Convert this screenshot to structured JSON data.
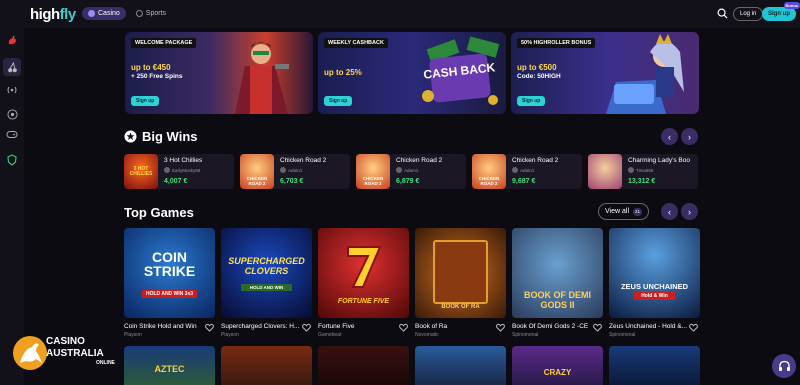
{
  "header": {
    "logo": {
      "part1": "high",
      "part2": "fly"
    },
    "modes": [
      {
        "label": "Casino"
      },
      {
        "label": "Sports"
      }
    ],
    "login_label": "Log in",
    "signup_label": "Sign up",
    "signup_badge": "Bonus"
  },
  "promos": [
    {
      "tag": "WELCOME PACKAGE",
      "amount": "up to €450",
      "sub": "+ 250 Free Spins",
      "button": "Sign up"
    },
    {
      "tag": "WEEKLY CASHBACK",
      "amount": "up to 25%",
      "sub": "",
      "art_text": "CASH BACK",
      "button": "Sign up"
    },
    {
      "tag": "50% HIGHROLLER BONUS",
      "amount": "up to €500",
      "sub": "Code: 50HIGH",
      "button": "Sign up"
    }
  ],
  "big_wins": {
    "title": "Big Wins",
    "items": [
      {
        "name": "3 Hot Chillies",
        "user": "EarlyMusky68",
        "amount": "4,007 €",
        "thumb_text": "3 HOT CHILLIES"
      },
      {
        "name": "Chicken Road 2",
        "user": "Adam1",
        "amount": "6,703 €",
        "thumb_text": "CHICKEN ROAD 2"
      },
      {
        "name": "Chicken Road 2",
        "user": "Adam1",
        "amount": "6,879 €",
        "thumb_text": "CHICKEN ROAD 2"
      },
      {
        "name": "Chicken Road 2",
        "user": "Adam1",
        "amount": "9,687 €",
        "thumb_text": "CHICKEN ROAD 2"
      },
      {
        "name": "Charming Lady's Boo",
        "user": "Tima666",
        "amount": "13,312 €",
        "thumb_text": ""
      }
    ]
  },
  "top_games": {
    "title": "Top Games",
    "view_all": "View all",
    "count": "21",
    "items": [
      {
        "title": "Coin Strike Hold and Win",
        "provider": "Playson",
        "art": "COIN STRIKE",
        "art2": "HOLD AND WIN 3x3"
      },
      {
        "title": "Supercharged Clovers: H...",
        "provider": "Playson",
        "art": "SUPERCHARGED CLOVERS",
        "art2": "HOLD AND WIN"
      },
      {
        "title": "Fortune Five",
        "provider": "Gamebeat",
        "art": "FORTUNE FIVE",
        "art2": ""
      },
      {
        "title": "Book of Ra",
        "provider": "Novomatic",
        "art": "BOOK OF RA",
        "art2": ""
      },
      {
        "title": "Book Of Demi Gods 2 -CE",
        "provider": "Spinomenal",
        "art": "BOOK OF DEMI GODS II",
        "art2": ""
      },
      {
        "title": "Zeus Unchained - Hold &...",
        "provider": "Spinomenal",
        "art": "ZEUS UNCHAINED",
        "art2": "Hold & Win"
      }
    ],
    "row2_art": [
      "AZTEC",
      "",
      "",
      "",
      "CRAZY",
      ""
    ]
  },
  "watermark": {
    "line1": "CASINO",
    "line2": "AUSTRALIA",
    "line3": "ONLINE"
  },
  "colors": {
    "accent": "#3a2d66",
    "cyan": "#1fc7d4",
    "win_green": "#3fe07a",
    "promo_yellow": "#ffd84a"
  }
}
